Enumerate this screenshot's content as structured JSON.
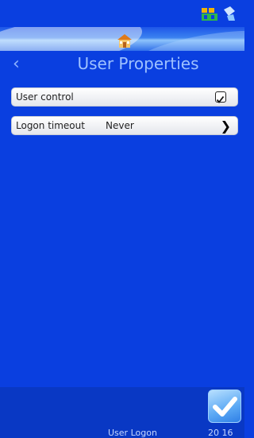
{
  "header": {
    "title": "User Properties"
  },
  "rows": [
    {
      "label": "User control",
      "value": "",
      "control": "checkbox",
      "checked": true
    },
    {
      "label": "Logon timeout",
      "value": "Never",
      "control": "chevron"
    }
  ],
  "footer": {
    "user": "User Logon",
    "time": "20 16"
  },
  "colors": {
    "background": "#0a3fe0",
    "title": "#9ec1ff",
    "row": "#f2f3f6"
  },
  "icons": [
    "status-network-icon",
    "status-print-icon",
    "home-icon",
    "back-chevron-icon",
    "chevron-right-icon",
    "confirm-check-icon"
  ]
}
